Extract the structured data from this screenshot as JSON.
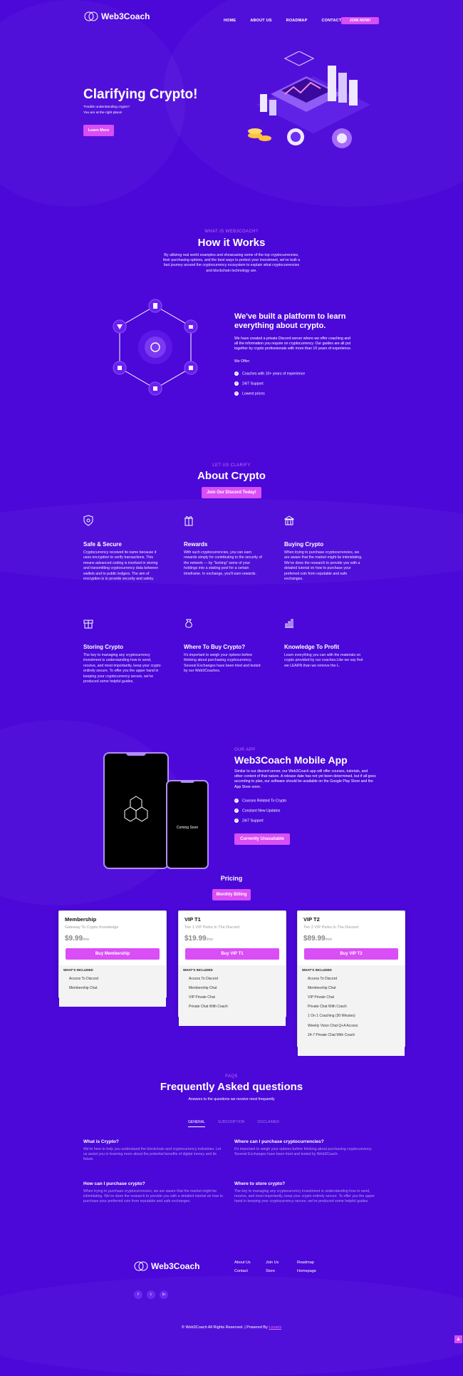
{
  "header": {
    "logo": "Web3Coach",
    "nav": [
      "HOME",
      "ABOUT US",
      "ROADMAP",
      "CONTACT"
    ],
    "join": "JOIN NOW!"
  },
  "hero": {
    "title": "Clarifying Crypto!",
    "line1": "Trouble understanding crypto?",
    "line2": "You are at the right place!",
    "cta": "Learn More"
  },
  "how": {
    "kicker": "WHAT IS WEB3COACH?",
    "title": "How it Works",
    "text": "By utilizing real world examples and showcasing some of the top cryptocurrencies, their purchasing options, and the best ways to protect your investment, we've built a fast journey around the cryptocurrency ecosystem to explain what cryptocurrencies and blockchain technology are.",
    "platform_title": "We've built a platform to learn everything about crypto.",
    "platform_text": "We have created a private Discord server where we offer coaching and all the information you require on cryptocurrency. Our guides are all put together by crypto professionals with more than 10 years of experience.",
    "offer_label": "We Offer:",
    "offers": [
      "Coaches with 10+ years of experience",
      "24/7 Support",
      "Lowest prices"
    ]
  },
  "about": {
    "kicker": "LET US CLARIFY",
    "title": "About Crypto",
    "cta": "Join Our Discord Today!",
    "features": [
      {
        "title": "Safe & Secure",
        "icon": "shield-icon",
        "text": "Cryptocurrency received its name because it uses encryption to verify transactions. This means advanced coding is involved in storing and transmitting cryptocurrency data between wallets and to public ledgers. The aim of encryption is to provide security and safety."
      },
      {
        "title": "Rewards",
        "icon": "gift-icon",
        "text": "With such cryptocurrencies, you can earn rewards simply for contributing to the security of the network — by \"locking\" some of your holdings into a staking pool for a certain timeframe. In exchange, you'll earn rewards."
      },
      {
        "title": "Buying Crypto",
        "icon": "building-icon",
        "text": "When trying to purchase cryptocurrencies, we are aware that the market might be intimidating. We've done the research to provide you with a detailed tutorial on how to purchase your preferred coin from reputable and safe exchanges."
      },
      {
        "title": "Storing Crypto",
        "icon": "gift-box-icon",
        "text": "The key to managing any cryptocurrency investment is understanding how to send, receive, and most importantly, keep your crypto entirely secure. To offer you the upper hand in keeping your cryptocurrency secure, we've produced some helpful guides."
      },
      {
        "title": "Where To Buy Crypto?",
        "icon": "bag-icon",
        "text": "It's important to weigh your options before thinking about purchasing cryptocurrency. Several Exchanges have been tried and tested by our Web3Coaches."
      },
      {
        "title": "Knowledge To Profit",
        "icon": "chart-icon",
        "text": "Learn everything you can with the materials on crypto provided by our coaches.Like we say first we LEARN than we remove the L."
      }
    ]
  },
  "app": {
    "kicker": "OUR APP",
    "title": "Web3Coach Mobile App",
    "text": "Similar to our discord server, our Web3Coach app will offer courses, tutorials, and other content of that nature. A release date has not yet been determined, but if all goes according to plan, our software should be available on the Google Play Store and the App Store soon.",
    "features": [
      "Courses Related To Crypto",
      "Constant New Updates",
      "24/7 Support"
    ],
    "cta": "Currently Unavailable",
    "coming_soon": "Coming Soon"
  },
  "pricing": {
    "title": "Pricing",
    "toggle": "Monthly Billing",
    "included_label": "WHAT'S INCLUDED",
    "plans": [
      {
        "name": "Membership",
        "subtitle": "Gateway To Crypto Knowledge",
        "price": "$9.99",
        "period": "/mo",
        "button": "Buy Membership",
        "features": [
          "Access To Discord",
          "Membership Chat"
        ]
      },
      {
        "name": "VIP T1",
        "subtitle": "Tier 1 VIP Perks In The Discord",
        "price": "$19.99",
        "period": "/mo",
        "button": "Buy VIP T1",
        "features": [
          "Access To Discord",
          "Membership Chat",
          "VIP Private Chat",
          "Private Chat With Coach"
        ]
      },
      {
        "name": "VIP T2",
        "subtitle": "Tier 2 VIP Perks In The Discord",
        "price": "$89.99",
        "period": "/mo",
        "button": "Buy VIP T2",
        "features": [
          "Access To Discord",
          "Membership Chat",
          "VIP Private Chat",
          "Private Chat With Coach",
          "1 On 1 Coaching (30 Minutes)",
          "Weekly Voice Chat Q+A Access",
          "24-7 Private Chat With Coach"
        ]
      }
    ]
  },
  "faq": {
    "kicker": "FAQS",
    "title": "Frequently Asked questions",
    "subtitle": "Answers to the questions we receive most frequently",
    "tabs": [
      "GENERAL",
      "SUBSCRIPTION",
      "DISCLAIMER"
    ],
    "items": [
      {
        "q": "What is Crypto?",
        "a": "We're here to help you understand the blockchain and cryptocurrency industries. Let us assist you in learning more about the potential benefits of digital money and its future."
      },
      {
        "q": "Where can I purchase cryptocurrencies?",
        "a": "It's important to weigh your options before thinking about purchasing cryptocurrency. Several Exchanges have been tried and tested by Web3Coach."
      },
      {
        "q": "How can I purchase crypto?",
        "a": "When trying to purchase cryptocurrencies, we are aware that the market might be intimidating. We've done the research to provide you with a detailed tutorial on how to purchase your preferred coin from reputable and safe exchanges."
      },
      {
        "q": "Where to store crypto?",
        "a": "The key to managing any cryptocurrency investment is understanding how to send, receive, and most importantly, keep your crypto entirely secure. To offer you the upper hand in keeping your cryptocurrency secure, we've produced some helpful guides."
      }
    ]
  },
  "footer": {
    "logo": "Web3Coach",
    "links": [
      "About Us",
      "Join Us",
      "Roadmap",
      "Contact",
      "Store",
      "Homepage"
    ],
    "social": [
      "f",
      "t",
      "in"
    ],
    "copyright": "© Web3Coach All Rights Reserved. | Powered By",
    "powered": "Lozaris"
  },
  "colors": {
    "background": "#4b08d9",
    "accent": "#d94ef5"
  }
}
